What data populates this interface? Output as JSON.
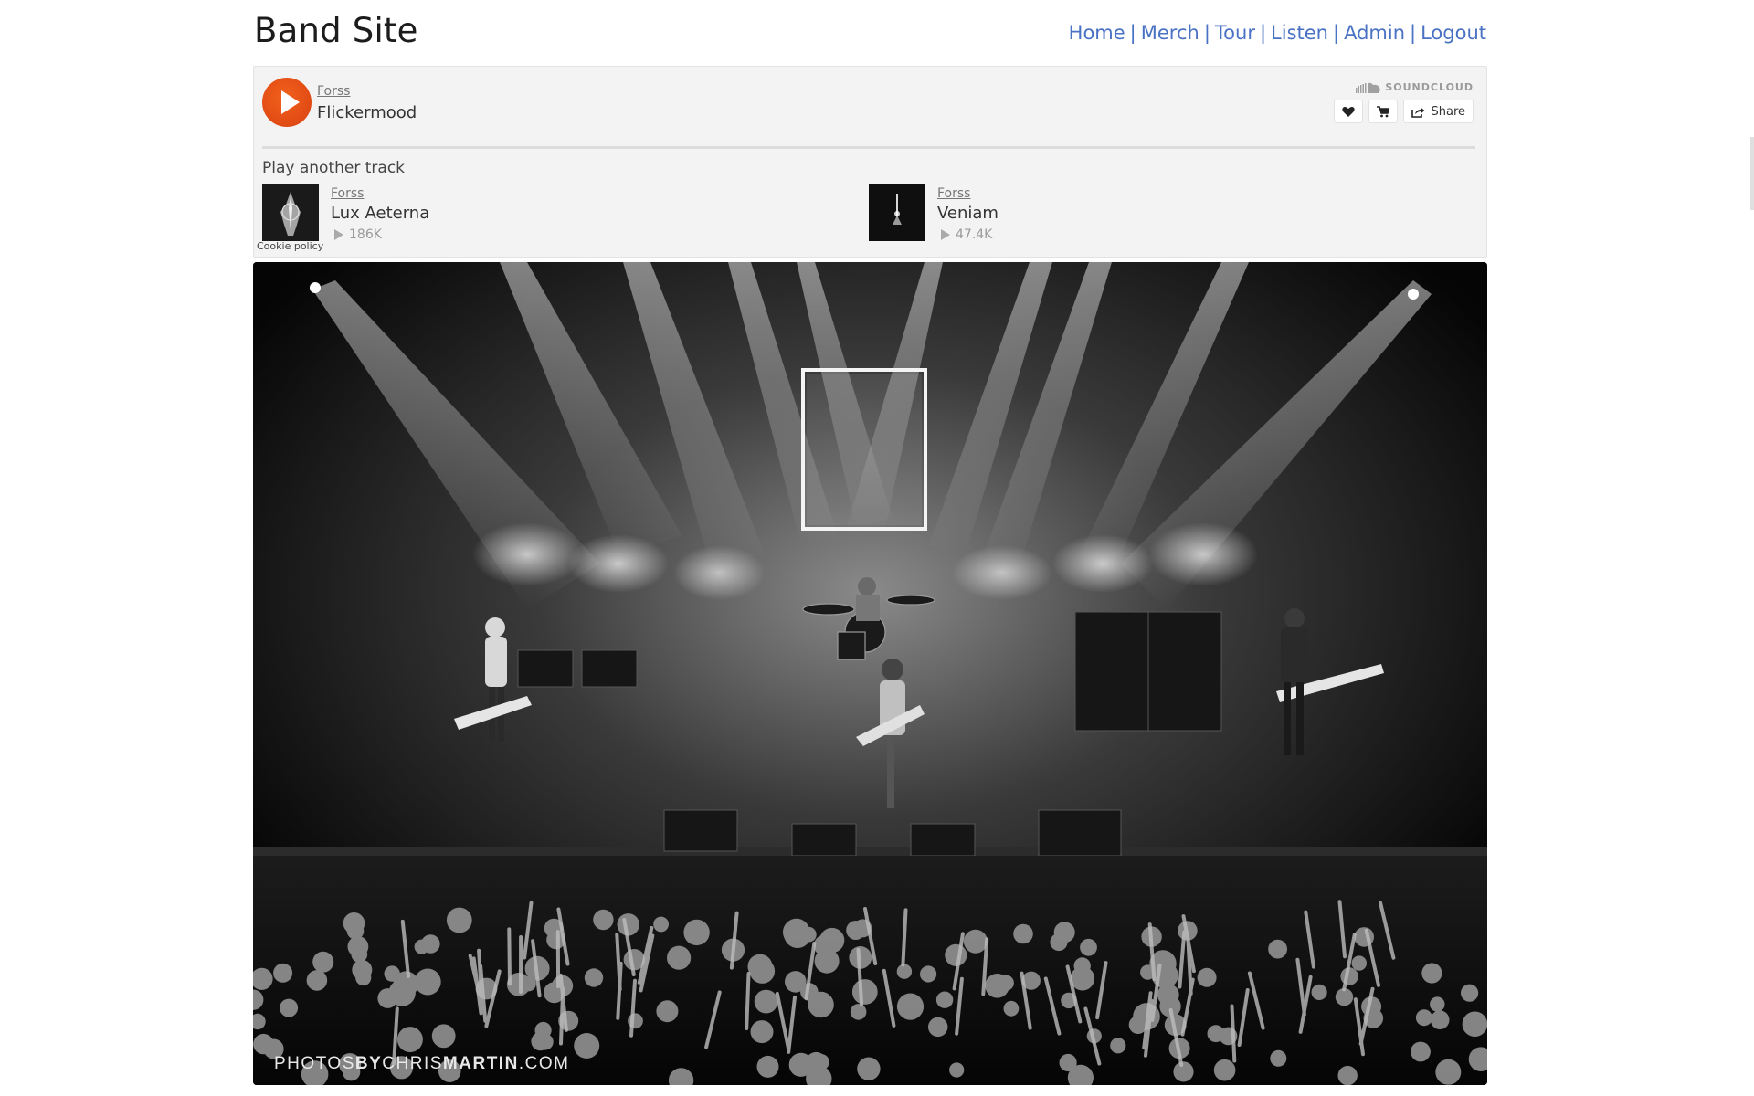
{
  "header": {
    "title": "Band Site",
    "nav": [
      "Home",
      "Merch",
      "Tour",
      "Listen",
      "Admin",
      "Logout"
    ]
  },
  "player": {
    "artist": "Forss",
    "track": "Flickermood",
    "brand": "SOUNDCLOUD",
    "share_label": "Share",
    "more_heading": "Play another track",
    "tracks": [
      {
        "artist": "Forss",
        "title": "Lux Aeterna",
        "plays": "186K"
      },
      {
        "artist": "Forss",
        "title": "Veniam",
        "plays": "47.4K"
      }
    ],
    "cookie": "Cookie policy"
  },
  "photo": {
    "credit_pre": "PHOTOS",
    "credit_by": "BY",
    "credit_name1": "CHRIS",
    "credit_name2": "MARTIN",
    "credit_suffix": ".COM"
  },
  "colors": {
    "accent": "#f2621d",
    "link": "#4a72c4"
  },
  "icons": [
    "play-icon",
    "heart-icon",
    "cart-icon",
    "share-icon",
    "soundcloud-icon"
  ]
}
